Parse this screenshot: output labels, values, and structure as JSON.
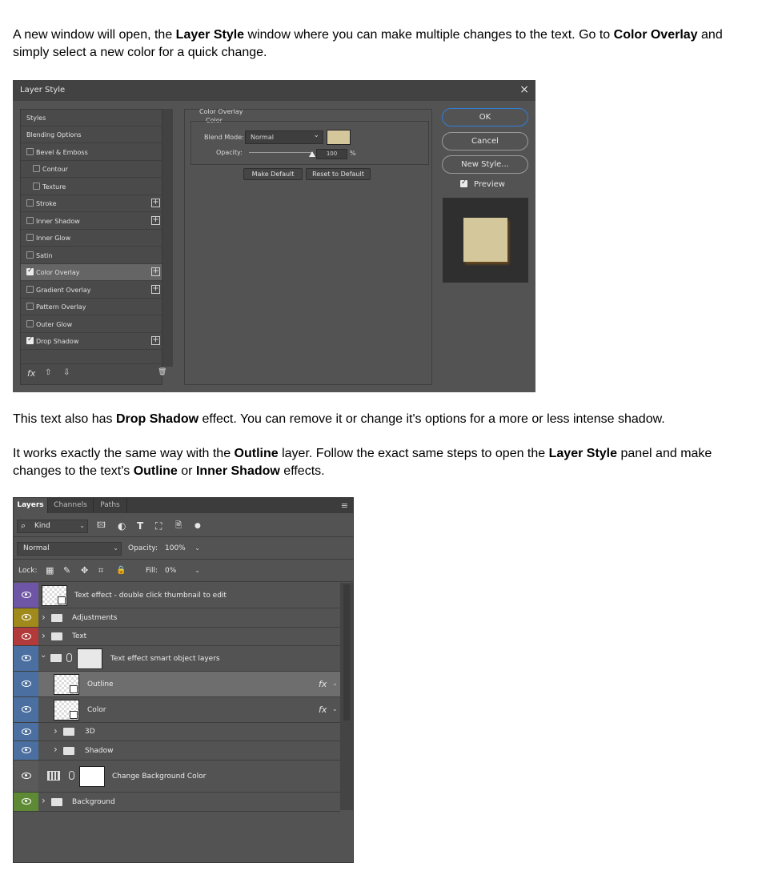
{
  "paragraphs": {
    "p1": {
      "a": "A new window will open, the ",
      "b": "Layer Style",
      "c": " window where you can make multiple changes to the text. Go to ",
      "d": "Color Overlay",
      "e": " and simply select a new color for a quick change."
    },
    "p2": {
      "a": "This text also has ",
      "b": "Drop Shadow",
      "c": " effect. You can  remove it or change it's options for a more or less intense shadow."
    },
    "p3": {
      "a": "It works exactly the same way with the ",
      "b": "Outline",
      "c": " layer. Follow the exact same steps to open the ",
      "d": "Layer Style",
      "e": " panel and make changes to the text's ",
      "f": "Outline",
      "g": " or ",
      "h": "Inner Shadow",
      "i": " effects."
    }
  },
  "layer_style": {
    "title": "Layer Style",
    "close_glyph": "×",
    "styles_header": "Styles",
    "blending_options": "Blending Options",
    "items": [
      {
        "label": "Bevel & Emboss",
        "checked": false,
        "plus": false
      },
      {
        "label": "Contour",
        "checked": false,
        "plus": false
      },
      {
        "label": "Texture",
        "checked": false,
        "plus": false
      },
      {
        "label": "Stroke",
        "checked": false,
        "plus": true
      },
      {
        "label": "Inner Shadow",
        "checked": false,
        "plus": true
      },
      {
        "label": "Inner Glow",
        "checked": false,
        "plus": false
      },
      {
        "label": "Satin",
        "checked": false,
        "plus": false
      },
      {
        "label": "Color Overlay",
        "checked": true,
        "plus": true
      },
      {
        "label": "Gradient Overlay",
        "checked": false,
        "plus": true
      },
      {
        "label": "Pattern Overlay",
        "checked": false,
        "plus": false
      },
      {
        "label": "Outer Glow",
        "checked": false,
        "plus": false
      },
      {
        "label": "Drop Shadow",
        "checked": true,
        "plus": true
      }
    ],
    "plus_glyph": "+",
    "footer": {
      "fx": "fx",
      "up": "⇧",
      "down": "⇩",
      "trash": "🗑"
    },
    "color_overlay": {
      "group_title": "Color Overlay",
      "sub_title": "Color",
      "blend_mode_label": "Blend Mode:",
      "blend_mode_value": "Normal",
      "blend_chevron": "⌄",
      "opacity_label": "Opacity:",
      "opacity_value": "100",
      "opacity_unit": "%",
      "overlay_color": "#d3c79b",
      "make_default": "Make Default",
      "reset_default": "Reset to Default"
    },
    "buttons": {
      "ok": "OK",
      "cancel": "Cancel",
      "new_style": "New Style..."
    },
    "preview_label": "Preview",
    "preview_checked": true
  },
  "layers_panel": {
    "tabs": [
      "Layers",
      "Channels",
      "Paths"
    ],
    "menu_glyph": "≡",
    "kind_label": "Kind",
    "kind_search_glyph": "⌕",
    "filter_icons": [
      "🖾",
      "◐",
      "T",
      "⛶",
      "🗎",
      "●"
    ],
    "blend_mode": "Normal",
    "opacity_label": "Opacity:",
    "opacity_value": "100%",
    "lock_label": "Lock:",
    "lock_icons": [
      "▦",
      "✎",
      "✥",
      "⌗",
      "🔒"
    ],
    "fill_label": "Fill:",
    "fill_value": "0%",
    "chevron": "⌄",
    "expand_right": "›",
    "expand_down": "⌄",
    "fx_label": "fx",
    "layers": [
      {
        "name": "Text effect - double click thumbnail to edit",
        "color": "#6f55a6"
      },
      {
        "name": "Adjustments",
        "color": "#a08a1c"
      },
      {
        "name": "Text",
        "color": "#b23a3a"
      },
      {
        "name": "Text effect smart object layers",
        "color": "#4a6fa0"
      },
      {
        "name": "Outline",
        "color": "#4a6fa0"
      },
      {
        "name": "Color",
        "color": "#4a6fa0"
      },
      {
        "name": "3D",
        "color": "#4a6fa0"
      },
      {
        "name": "Shadow",
        "color": "#4a6fa0"
      },
      {
        "name": "Change Background Color",
        "color": "#5a5a5a"
      },
      {
        "name": "Background",
        "color": "#5e8a35"
      }
    ]
  }
}
